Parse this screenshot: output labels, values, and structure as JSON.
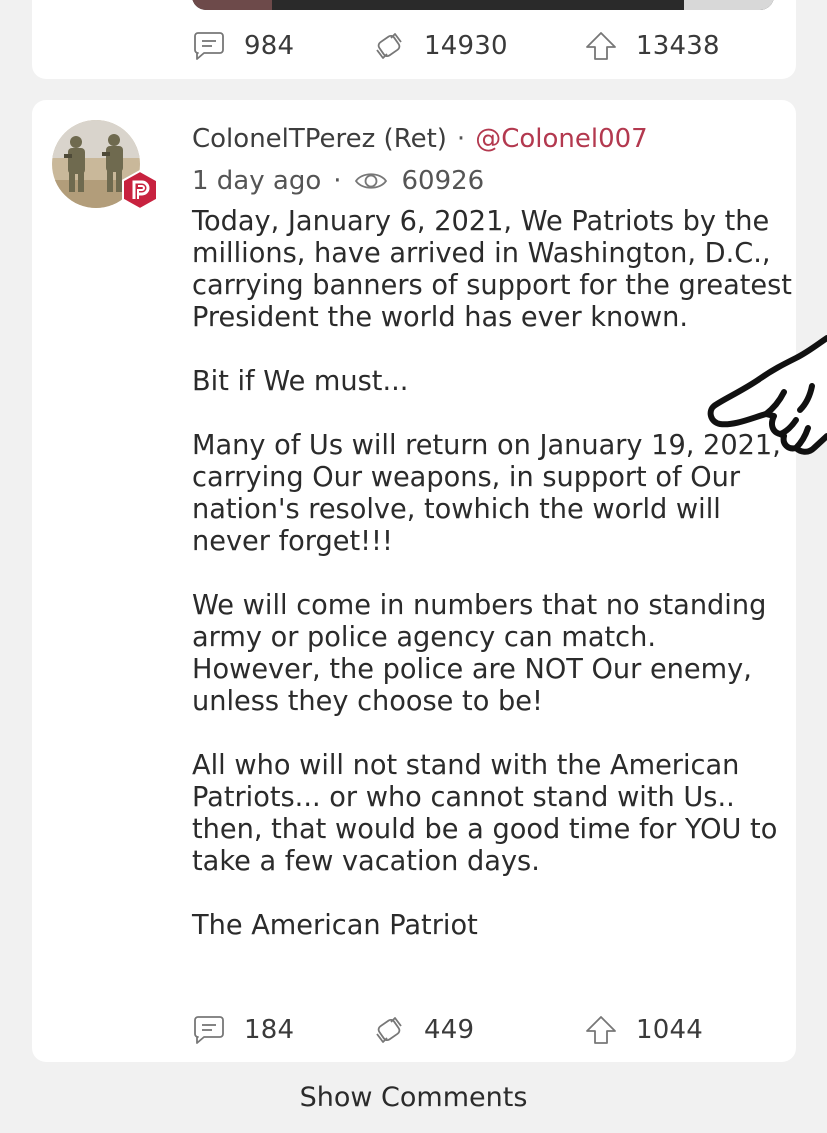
{
  "previous_post": {
    "comments_count": "984",
    "reposts_count": "14930",
    "upvotes_count": "13438"
  },
  "post": {
    "author_name": "ColonelTPerez (Ret)",
    "separator": "·",
    "author_handle": "@Colonel007",
    "timestamp": "1 day ago",
    "views_count": "60926",
    "paragraphs": [
      "Today, January 6, 2021, We Patriots by the millions, have arrived in Washington, D.C., carrying banners of support for the greatest President the world has ever known.",
      "Bit if We must...",
      "Many of Us will return on January 19, 2021, carrying Our weapons, in support of Our nation's resolve, towhich the world will never forget!!!",
      "We will come in numbers that no standing army or police agency can match. However, the police are NOT Our enemy, unless they choose to be!",
      "All who will not stand with the American Patriots... or who cannot stand with Us.. then, that would be a good time for YOU to take a few vacation days.",
      "The American Patriot"
    ],
    "comments_count": "184",
    "reposts_count": "449",
    "upvotes_count": "1044"
  },
  "show_comments_label": "Show Comments",
  "colors": {
    "handle": "#b3394f",
    "badge": "#c8223f",
    "background": "#f1f1f1",
    "card": "#ffffff"
  },
  "icons": {
    "comment": "comment-icon",
    "repost": "repost-icon",
    "upvote": "upvote-icon",
    "views": "eye-icon",
    "badge": "parler-badge-icon",
    "overlay": "pointing-hand-icon"
  }
}
